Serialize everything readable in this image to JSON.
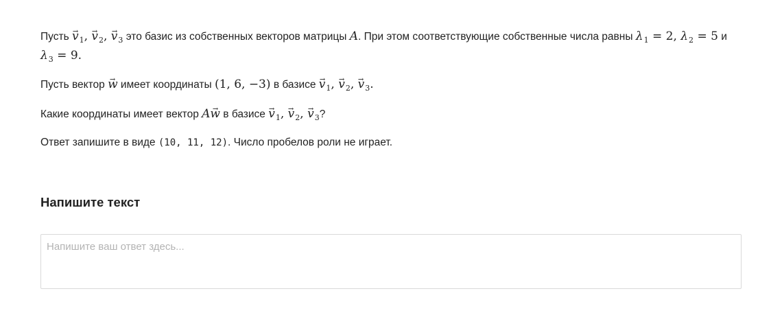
{
  "question": {
    "p1_a": "Пусть ",
    "p1_b": " это базис из собственных векторов матрицы ",
    "p1_c": ". При этом соответствующие собственные числа равны ",
    "p1_and": " и ",
    "p2_a": "Пусть вектор ",
    "p2_b": " имеет координаты ",
    "p2_c": " в базисе ",
    "p3_a": "Какие координаты имеет вектор ",
    "p3_b": " в базисе ",
    "p3_q": "?",
    "p4_a": "Ответ запишите в виде ",
    "p4_code": "(10, 11, 12)",
    "p4_b": ". Число пробелов роли не играет.",
    "matrix_name": "A",
    "vector_letter": "v",
    "w_letter": "w",
    "lambda": "λ",
    "coordinates": "(1, 6, −3)",
    "eigenvalues": [
      "2",
      "5",
      "9"
    ],
    "indices": [
      "1",
      "2",
      "3"
    ]
  },
  "answer": {
    "title": "Напишите текст",
    "placeholder": "Напишите ваш ответ здесь..."
  }
}
